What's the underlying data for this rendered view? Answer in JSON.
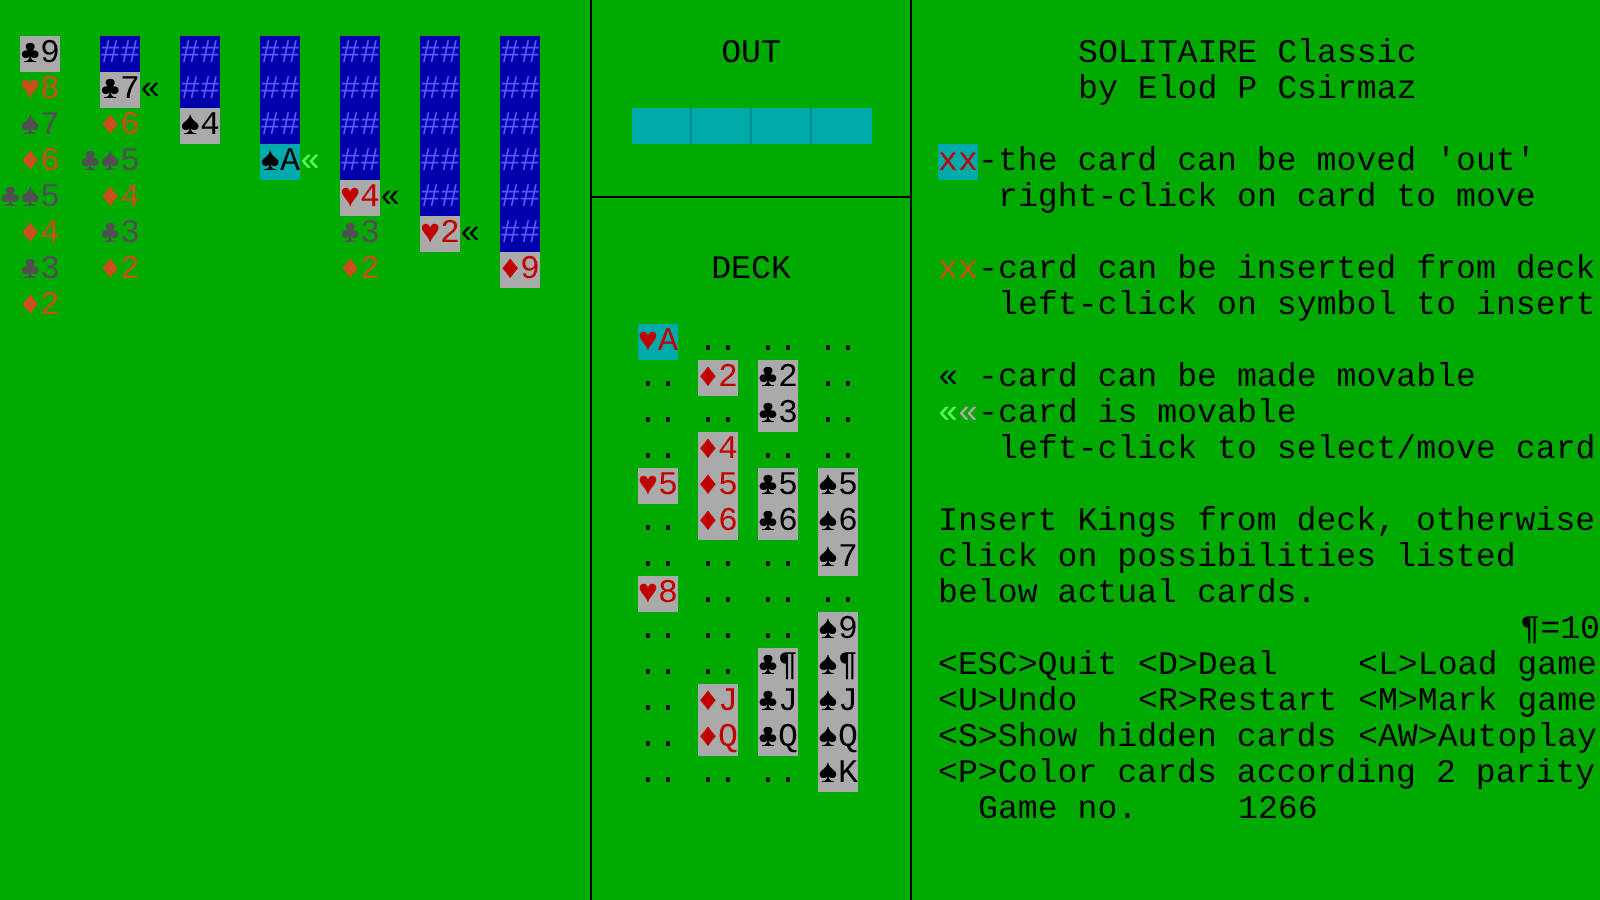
{
  "tableau": [
    {
      "cards": [
        {
          "kind": "face",
          "text": "♣9",
          "red": false,
          "highlighted": false
        },
        {
          "kind": "hint",
          "text": "♥8",
          "red": true
        },
        {
          "kind": "hint",
          "text": "♠7",
          "red": false
        },
        {
          "kind": "hint",
          "text": "♦6",
          "red": true
        },
        {
          "kind": "hint",
          "text": "♣♠5",
          "red": false
        },
        {
          "kind": "hint",
          "text": "♦4",
          "red": true
        },
        {
          "kind": "hint",
          "text": "♣3",
          "red": false
        },
        {
          "kind": "hint",
          "text": "♦2",
          "red": true
        }
      ]
    },
    {
      "cards": [
        {
          "kind": "back",
          "text": "##"
        },
        {
          "kind": "face",
          "text": "♣7",
          "red": false,
          "highlighted": false,
          "marker": "«",
          "movable": false
        },
        {
          "kind": "hint",
          "text": "♦6",
          "red": true
        },
        {
          "kind": "hint",
          "text": "♣♠5",
          "red": false
        },
        {
          "kind": "hint",
          "text": "♦4",
          "red": true
        },
        {
          "kind": "hint",
          "text": "♣3",
          "red": false
        },
        {
          "kind": "hint",
          "text": "♦2",
          "red": true
        }
      ]
    },
    {
      "cards": [
        {
          "kind": "back",
          "text": "##"
        },
        {
          "kind": "back",
          "text": "##"
        },
        {
          "kind": "face",
          "text": "♠4",
          "red": false,
          "highlighted": false
        }
      ]
    },
    {
      "cards": [
        {
          "kind": "back",
          "text": "##"
        },
        {
          "kind": "back",
          "text": "##"
        },
        {
          "kind": "back",
          "text": "##"
        },
        {
          "kind": "face",
          "text": "♠A",
          "red": false,
          "highlighted": true,
          "marker": "«",
          "movable": true
        }
      ]
    },
    {
      "cards": [
        {
          "kind": "back",
          "text": "##"
        },
        {
          "kind": "back",
          "text": "##"
        },
        {
          "kind": "back",
          "text": "##"
        },
        {
          "kind": "back",
          "text": "##"
        },
        {
          "kind": "face",
          "text": "♥4",
          "red": true,
          "highlighted": false,
          "marker": "«",
          "movable": false
        },
        {
          "kind": "hint",
          "text": "♣3",
          "red": false
        },
        {
          "kind": "hint",
          "text": "♦2",
          "red": true
        }
      ]
    },
    {
      "cards": [
        {
          "kind": "back",
          "text": "##"
        },
        {
          "kind": "back",
          "text": "##"
        },
        {
          "kind": "back",
          "text": "##"
        },
        {
          "kind": "back",
          "text": "##"
        },
        {
          "kind": "back",
          "text": "##"
        },
        {
          "kind": "face",
          "text": "♥2",
          "red": true,
          "highlighted": false,
          "marker": "«",
          "movable": false
        }
      ]
    },
    {
      "cards": [
        {
          "kind": "back",
          "text": "##"
        },
        {
          "kind": "back",
          "text": "##"
        },
        {
          "kind": "back",
          "text": "##"
        },
        {
          "kind": "back",
          "text": "##"
        },
        {
          "kind": "back",
          "text": "##"
        },
        {
          "kind": "back",
          "text": "##"
        },
        {
          "kind": "face",
          "text": "♦9",
          "red": true,
          "highlighted": false
        }
      ]
    }
  ],
  "out": {
    "title": "OUT"
  },
  "deck": {
    "title": "DECK",
    "rows": [
      [
        {
          "kind": "card",
          "text": "♥A",
          "red": true,
          "highlighted": true
        },
        {
          "kind": "empty",
          "text": ".."
        },
        {
          "kind": "empty",
          "text": ".."
        },
        {
          "kind": "empty",
          "text": ".."
        }
      ],
      [
        {
          "kind": "empty",
          "text": ".."
        },
        {
          "kind": "card",
          "text": "♦2",
          "red": true,
          "highlighted": false
        },
        {
          "kind": "card",
          "text": "♣2",
          "red": false,
          "highlighted": false
        },
        {
          "kind": "empty",
          "text": ".."
        }
      ],
      [
        {
          "kind": "empty",
          "text": ".."
        },
        {
          "kind": "empty",
          "text": ".."
        },
        {
          "kind": "card",
          "text": "♣3",
          "red": false,
          "highlighted": false
        },
        {
          "kind": "empty",
          "text": ".."
        }
      ],
      [
        {
          "kind": "empty",
          "text": ".."
        },
        {
          "kind": "card",
          "text": "♦4",
          "red": true,
          "highlighted": false
        },
        {
          "kind": "empty",
          "text": ".."
        },
        {
          "kind": "empty",
          "text": ".."
        }
      ],
      [
        {
          "kind": "card",
          "text": "♥5",
          "red": true,
          "highlighted": false
        },
        {
          "kind": "card",
          "text": "♦5",
          "red": true,
          "highlighted": false
        },
        {
          "kind": "card",
          "text": "♣5",
          "red": false,
          "highlighted": false
        },
        {
          "kind": "card",
          "text": "♠5",
          "red": false,
          "highlighted": false
        }
      ],
      [
        {
          "kind": "empty",
          "text": ".."
        },
        {
          "kind": "card",
          "text": "♦6",
          "red": true,
          "highlighted": false
        },
        {
          "kind": "card",
          "text": "♣6",
          "red": false,
          "highlighted": false
        },
        {
          "kind": "card",
          "text": "♠6",
          "red": false,
          "highlighted": false
        }
      ],
      [
        {
          "kind": "empty",
          "text": ".."
        },
        {
          "kind": "empty",
          "text": ".."
        },
        {
          "kind": "empty",
          "text": ".."
        },
        {
          "kind": "card",
          "text": "♠7",
          "red": false,
          "highlighted": false
        }
      ],
      [
        {
          "kind": "card",
          "text": "♥8",
          "red": true,
          "highlighted": false
        },
        {
          "kind": "empty",
          "text": ".."
        },
        {
          "kind": "empty",
          "text": ".."
        },
        {
          "kind": "empty",
          "text": ".."
        }
      ],
      [
        {
          "kind": "empty",
          "text": ".."
        },
        {
          "kind": "empty",
          "text": ".."
        },
        {
          "kind": "empty",
          "text": ".."
        },
        {
          "kind": "card",
          "text": "♠9",
          "red": false,
          "highlighted": false
        }
      ],
      [
        {
          "kind": "empty",
          "text": ".."
        },
        {
          "kind": "empty",
          "text": ".."
        },
        {
          "kind": "card",
          "text": "♣¶",
          "red": false,
          "highlighted": false
        },
        {
          "kind": "card",
          "text": "♠¶",
          "red": false,
          "highlighted": false
        }
      ],
      [
        {
          "kind": "empty",
          "text": ".."
        },
        {
          "kind": "card",
          "text": "♦J",
          "red": true,
          "highlighted": false
        },
        {
          "kind": "card",
          "text": "♣J",
          "red": false,
          "highlighted": false
        },
        {
          "kind": "card",
          "text": "♠J",
          "red": false,
          "highlighted": false
        }
      ],
      [
        {
          "kind": "empty",
          "text": ".."
        },
        {
          "kind": "card",
          "text": "♦Q",
          "red": true,
          "highlighted": false
        },
        {
          "kind": "card",
          "text": "♣Q",
          "red": false,
          "highlighted": false
        },
        {
          "kind": "card",
          "text": "♠Q",
          "red": false,
          "highlighted": false
        }
      ],
      [
        {
          "kind": "empty",
          "text": ".."
        },
        {
          "kind": "empty",
          "text": ".."
        },
        {
          "kind": "empty",
          "text": ".."
        },
        {
          "kind": "card",
          "text": "♠K",
          "red": false,
          "highlighted": false
        }
      ]
    ]
  },
  "title": "SOLITAIRE Classic",
  "author": "by Elod P Csirmaz",
  "legend_groups": [
    [
      {
        "kind": "out",
        "symbol": "xx",
        "text": "-the card can be moved 'out'",
        "hint": "right-click on card to move"
      }
    ],
    [
      {
        "kind": "insert",
        "symbol": "xx",
        "text": "-card can be inserted from deck",
        "hint": "left-click on symbol to insert"
      }
    ],
    [
      {
        "kind": "makeable",
        "symbol": "«",
        "text": "-card can be made movable"
      },
      {
        "kind": "movable",
        "symbol": "««",
        "text": "-card is movable",
        "hint": "left-click to select/move card"
      }
    ]
  ],
  "help": [
    "Insert Kings from deck, otherwise",
    "click on possibilities listed",
    "below actual cards."
  ],
  "ten_note": "¶=10",
  "commands": [
    [
      {
        "kind": "normal",
        "text": "<ESC>Quit"
      },
      {
        "kind": "normal",
        "text": "<D>Deal"
      },
      {
        "kind": "normal",
        "text": "<L>Load game"
      }
    ],
    [
      {
        "kind": "normal",
        "text": "<U>Undo"
      },
      {
        "kind": "normal",
        "text": "<R>Restart"
      },
      {
        "kind": "normal",
        "text": "<M>Mark game"
      }
    ],
    [
      {
        "kind": "wide",
        "text": "<S>Show hidden cards"
      },
      {
        "kind": "normal",
        "text": "<AW>Autoplay"
      }
    ],
    [
      {
        "kind": "full",
        "text": "<P>Color cards according 2 parity"
      }
    ]
  ],
  "game": {
    "label": "Game no.",
    "value": "1266"
  }
}
